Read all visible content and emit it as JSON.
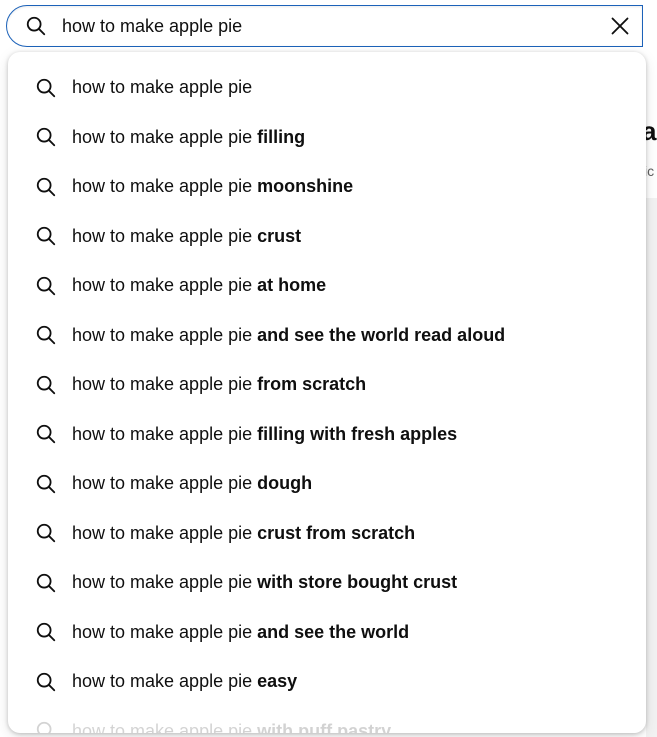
{
  "search": {
    "query": "how to make apple pie",
    "search_icon": "search-icon",
    "clear_icon": "close-icon",
    "border_color": "#1c62b9"
  },
  "background_page": {
    "title_fragment": "a",
    "subtitle_fragment": "ic"
  },
  "suggestions": {
    "icon": "search-icon",
    "items": [
      {
        "prefix": "how to make apple pie",
        "suffix": ""
      },
      {
        "prefix": "how to make apple pie ",
        "suffix": "filling"
      },
      {
        "prefix": "how to make apple pie ",
        "suffix": "moonshine"
      },
      {
        "prefix": "how to make apple pie ",
        "suffix": "crust"
      },
      {
        "prefix": "how to make apple pie ",
        "suffix": "at home"
      },
      {
        "prefix": "how to make apple pie ",
        "suffix": "and see the world read aloud"
      },
      {
        "prefix": "how to make apple pie ",
        "suffix": "from scratch"
      },
      {
        "prefix": "how to make apple pie ",
        "suffix": "filling with fresh apples"
      },
      {
        "prefix": "how to make apple pie ",
        "suffix": "dough"
      },
      {
        "prefix": "how to make apple pie ",
        "suffix": "crust from scratch"
      },
      {
        "prefix": "how to make apple pie ",
        "suffix": "with store bought crust"
      },
      {
        "prefix": "how to make apple pie ",
        "suffix": "and see the world"
      },
      {
        "prefix": "how to make apple pie ",
        "suffix": "easy"
      },
      {
        "prefix": "how to make apple pie ",
        "suffix": "with puff pastry"
      }
    ]
  }
}
